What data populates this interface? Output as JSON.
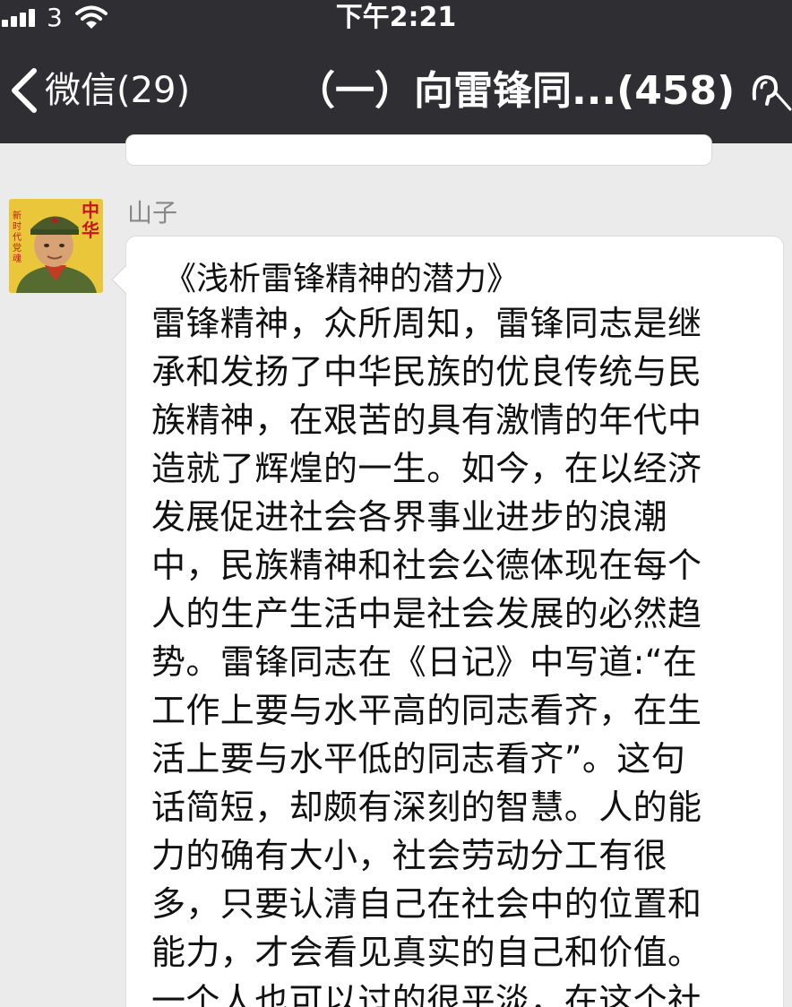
{
  "status_bar": {
    "carrier": "3",
    "time": "下午2:21",
    "icons": [
      "signal-bars-icon",
      "wifi-icon"
    ]
  },
  "nav_bar": {
    "back_label": "微信(29)",
    "title": "（一）向雷锋同...(458)",
    "icons": [
      "chevron-left-icon",
      "mute-icon"
    ]
  },
  "message": {
    "sender_name": "山子",
    "avatar_text": {
      "main": "中华",
      "side": "新时代党魂"
    },
    "title": "《浅析雷锋精神的潜力》",
    "lines": [
      "雷锋精神，众所周知，雷锋同志是继",
      "承和发扬了中华民族的优良传统与民",
      "族精神，在艰苦的具有激情的年代中",
      "造就了辉煌的一生。如今，在以经济",
      "发展促进社会各界事业进步的浪潮",
      "中，民族精神和社会公德体现在每个",
      "人的生产生活中是社会发展的必然趋",
      "势。雷锋同志在《日记》中写道:“在",
      "工作上要与水平高的同志看齐，在生",
      "活上要与水平低的同志看齐”。这句",
      "话简短，却颇有深刻的智慧。人的能",
      "力的确有大小，社会劳动分工有很",
      "多，只要认清自己在社会中的位置和",
      "能力，才会看见真实的自己和价值。",
      "一个人也可以过的很平淡，在这个社"
    ]
  },
  "colors": {
    "nav_background": "#2e2e33",
    "chat_background": "#ebebeb",
    "bubble_background": "#ffffff",
    "sender_name": "#888888"
  }
}
